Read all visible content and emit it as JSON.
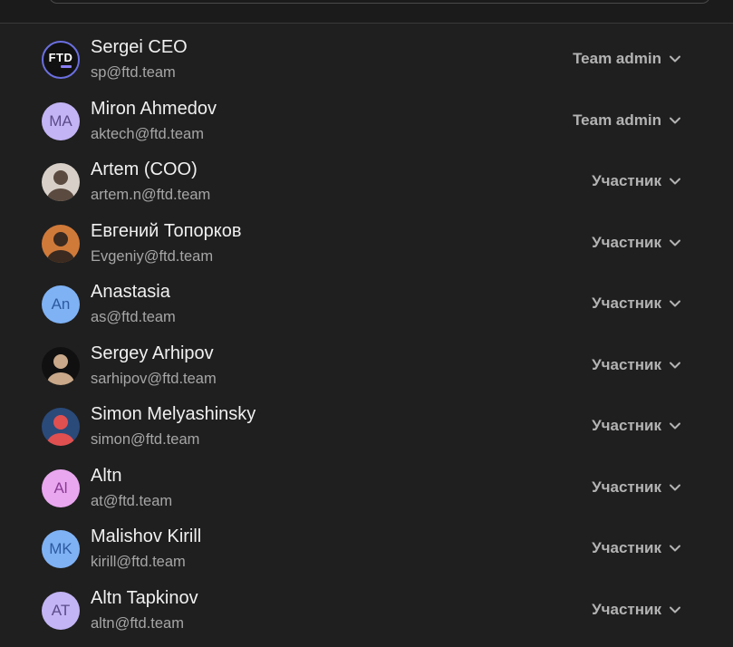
{
  "colors": {
    "background": "#1f1f1f",
    "name_text": "#f0f0f0",
    "email_text": "#a6a6a6",
    "role_text": "#b3b3b3"
  },
  "members": [
    {
      "name": "Sergei CEO",
      "email": "sp@ftd.team",
      "role": "Team admin",
      "avatar_type": "logo",
      "avatar_text": "FTD",
      "avatar_bg": "#111111",
      "avatar_fg": "#ffffff",
      "avatar_icon": "ftd-logo-icon"
    },
    {
      "name": "Miron Ahmedov",
      "email": "aktech@ftd.team",
      "role": "Team admin",
      "avatar_type": "initials",
      "avatar_text": "MA",
      "avatar_bg": "#c3b4f5",
      "avatar_fg": "#5a4a8a"
    },
    {
      "name": "Artem (COO)",
      "email": "artem.n@ftd.team",
      "role": "Участник",
      "avatar_type": "photo",
      "avatar_icon": "user-photo-icon",
      "avatar_bg": "#d8d0c8",
      "avatar_fg": "#5a4a40"
    },
    {
      "name": "Евгений Топорков",
      "email": "Evgeniy@ftd.team",
      "role": "Участник",
      "avatar_type": "photo",
      "avatar_icon": "user-photo-icon",
      "avatar_bg": "#d07a3a",
      "avatar_fg": "#3a2a20"
    },
    {
      "name": "Anastasia",
      "email": "as@ftd.team",
      "role": "Участник",
      "avatar_type": "initials",
      "avatar_text": "An",
      "avatar_bg": "#7fb2f5",
      "avatar_fg": "#2d5aa0"
    },
    {
      "name": "Sergey Arhipov",
      "email": "sarhipov@ftd.team",
      "role": "Участник",
      "avatar_type": "photo",
      "avatar_icon": "user-photo-icon",
      "avatar_bg": "#101010",
      "avatar_fg": "#c9a98a"
    },
    {
      "name": "Simon Melyashinsky",
      "email": "simon@ftd.team",
      "role": "Участник",
      "avatar_type": "photo",
      "avatar_icon": "user-photo-icon",
      "avatar_bg": "#2a4a7a",
      "avatar_fg": "#e05050"
    },
    {
      "name": "Altn",
      "email": "at@ftd.team",
      "role": "Участник",
      "avatar_type": "initials",
      "avatar_text": "Al",
      "avatar_bg": "#e9a7ef",
      "avatar_fg": "#8a3a95"
    },
    {
      "name": "Malishov Kirill",
      "email": "kirill@ftd.team",
      "role": "Участник",
      "avatar_type": "initials",
      "avatar_text": "MK",
      "avatar_bg": "#7fb2f5",
      "avatar_fg": "#2d5aa0"
    },
    {
      "name": "Altn Tapkinov",
      "email": "altn@ftd.team",
      "role": "Участник",
      "avatar_type": "initials",
      "avatar_text": "AT",
      "avatar_bg": "#c3b4f5",
      "avatar_fg": "#5a4a8a"
    }
  ]
}
